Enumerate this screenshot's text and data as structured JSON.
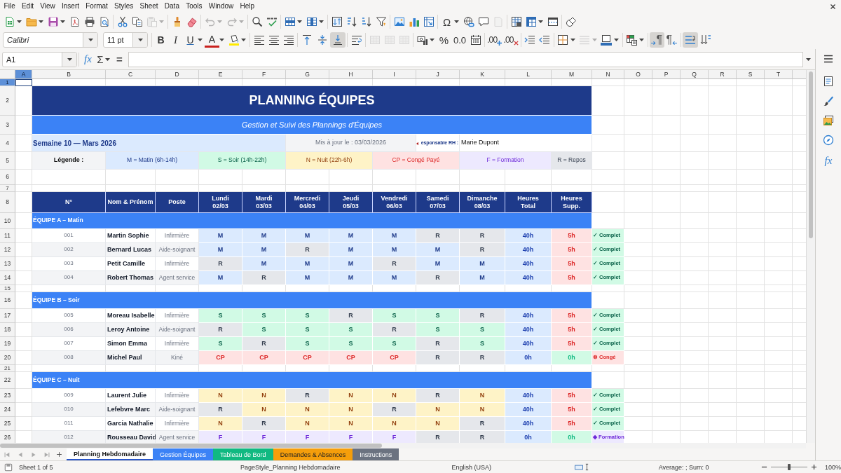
{
  "menu": [
    "File",
    "Edit",
    "View",
    "Insert",
    "Format",
    "Styles",
    "Sheet",
    "Data",
    "Tools",
    "Window",
    "Help"
  ],
  "standard_toolbar": {
    "paste": {
      "disabled": true
    },
    "undo": {
      "disabled": true
    },
    "redo": {
      "disabled": true
    },
    "special_character": "Ω",
    "header_footer": {
      "disabled": true
    }
  },
  "formatting_toolbar": {
    "font_name": "Calibri",
    "font_size": "11 pt",
    "bold": "B",
    "italic": "I",
    "underline": "U",
    "font_color": "A",
    "align_top": {
      "pressed": false
    },
    "align_middle": {
      "pressed": false
    },
    "align_bottom": {
      "pressed": true
    },
    "merge": {
      "disabled": true
    },
    "percent": "%",
    "standard_format": "0.0",
    "add_decimal": ".00",
    "delete_decimal": ".00",
    "border_style": {
      "disabled": true
    },
    "left_to_right": {
      "glyph": "¶",
      "pressed": true
    },
    "right_to_left": {
      "glyph": "¶",
      "pressed": false
    },
    "horizontal_text": {
      "pressed": true
    },
    "vertical_text": {
      "pressed": false
    }
  },
  "formula_bar": {
    "name_box": "A1",
    "function_wizard": "fx",
    "sum": "Σ",
    "formula": "="
  },
  "sidebar": {
    "functions": "fx"
  },
  "sheet": {
    "columns": [
      {
        "label": "A",
        "selected": true
      },
      {
        "label": "B",
        "selected": false
      },
      {
        "label": "C",
        "selected": false
      },
      {
        "label": "D",
        "selected": false
      },
      {
        "label": "E",
        "selected": false
      },
      {
        "label": "F",
        "selected": false
      },
      {
        "label": "G",
        "selected": false
      },
      {
        "label": "H",
        "selected": false
      },
      {
        "label": "I",
        "selected": false
      },
      {
        "label": "J",
        "selected": false
      },
      {
        "label": "K",
        "selected": false
      },
      {
        "label": "L",
        "selected": false
      },
      {
        "label": "M",
        "selected": false
      },
      {
        "label": "N",
        "selected": false
      },
      {
        "label": "O",
        "selected": false
      },
      {
        "label": "P",
        "selected": false
      },
      {
        "label": "Q",
        "selected": false
      },
      {
        "label": "R",
        "selected": false
      },
      {
        "label": "S",
        "selected": false
      },
      {
        "label": "T",
        "selected": false
      }
    ],
    "rows": [
      {
        "label": "1",
        "selected": true
      },
      {
        "label": "2",
        "selected": false
      },
      {
        "label": "3",
        "selected": false
      },
      {
        "label": "4",
        "selected": false
      },
      {
        "label": "5",
        "selected": false
      },
      {
        "label": "6",
        "selected": false
      },
      {
        "label": "7",
        "selected": false
      },
      {
        "label": "8",
        "selected": false
      },
      {
        "label": "10",
        "selected": false
      },
      {
        "label": "11",
        "selected": false
      },
      {
        "label": "12",
        "selected": false
      },
      {
        "label": "13",
        "selected": false
      },
      {
        "label": "14",
        "selected": false
      },
      {
        "label": "15",
        "selected": false
      },
      {
        "label": "16",
        "selected": false
      },
      {
        "label": "17",
        "selected": false
      },
      {
        "label": "18",
        "selected": false
      },
      {
        "label": "19",
        "selected": false
      },
      {
        "label": "20",
        "selected": false
      },
      {
        "label": "21",
        "selected": false
      },
      {
        "label": "22",
        "selected": false
      },
      {
        "label": "23",
        "selected": false
      },
      {
        "label": "24",
        "selected": false
      },
      {
        "label": "25",
        "selected": false
      },
      {
        "label": "26",
        "selected": false
      }
    ],
    "title": "PLANNING ÉQUIPES",
    "subtitle": "Gestion et Suivi des Plannings d'Équipes",
    "info": {
      "week": "Semaine 10 — Mars 2026",
      "updated": "Mis à jour le : 03/03/2026",
      "manager_label": "esponsable RH :",
      "manager": "Marie Dupont"
    },
    "legend": {
      "label": "Légende :",
      "items": [
        {
          "text": "M = Matin (6h-14h)",
          "kind": "matin"
        },
        {
          "text": "S = Soir (14h-22h)",
          "kind": "soir"
        },
        {
          "text": "N = Nuit (22h-6h)",
          "kind": "nuit"
        },
        {
          "text": "CP = Congé Payé",
          "kind": "conge"
        },
        {
          "text": "F = Formation",
          "kind": "formation"
        },
        {
          "text": "R = Repos",
          "kind": "repos"
        }
      ]
    },
    "table": {
      "columns": [
        "N°",
        "Nom & Prénom",
        "Poste",
        "Lundi\n02/03",
        "Mardi\n03/03",
        "Mercredi\n04/03",
        "Jeudi\n05/03",
        "Vendredi\n06/03",
        "Samedi\n07/03",
        "Dimanche\n08/03",
        "Heures\nTotal",
        "Heures\nSupp."
      ],
      "teams": [
        {
          "name": "ÉQUIPE A – Matin",
          "members": [
            {
              "number": "001",
              "name": "Martin Sophie",
              "role": "Infirmière",
              "shifts": [
                {
                  "code": "M",
                  "kind": "matin"
                },
                {
                  "code": "M",
                  "kind": "matin"
                },
                {
                  "code": "M",
                  "kind": "matin"
                },
                {
                  "code": "M",
                  "kind": "matin"
                },
                {
                  "code": "M",
                  "kind": "matin"
                },
                {
                  "code": "R",
                  "kind": "repos"
                },
                {
                  "code": "R",
                  "kind": "repos"
                }
              ],
              "total": "40h",
              "overtime": {
                "text": "5h",
                "kind": "extra"
              },
              "status": {
                "text": "✓ Complet",
                "kind": "complete"
              }
            },
            {
              "number": "002",
              "name": "Bernard Lucas",
              "role": "Aide-soignant",
              "shifts": [
                {
                  "code": "M",
                  "kind": "matin"
                },
                {
                  "code": "M",
                  "kind": "matin"
                },
                {
                  "code": "R",
                  "kind": "repos"
                },
                {
                  "code": "M",
                  "kind": "matin"
                },
                {
                  "code": "M",
                  "kind": "matin"
                },
                {
                  "code": "M",
                  "kind": "matin"
                },
                {
                  "code": "R",
                  "kind": "repos"
                }
              ],
              "total": "40h",
              "overtime": {
                "text": "5h",
                "kind": "extra"
              },
              "status": {
                "text": "✓ Complet",
                "kind": "complete"
              }
            },
            {
              "number": "003",
              "name": "Petit Camille",
              "role": "Infirmière",
              "shifts": [
                {
                  "code": "R",
                  "kind": "repos"
                },
                {
                  "code": "M",
                  "kind": "matin"
                },
                {
                  "code": "M",
                  "kind": "matin"
                },
                {
                  "code": "M",
                  "kind": "matin"
                },
                {
                  "code": "R",
                  "kind": "repos"
                },
                {
                  "code": "M",
                  "kind": "matin"
                },
                {
                  "code": "M",
                  "kind": "matin"
                }
              ],
              "total": "40h",
              "overtime": {
                "text": "5h",
                "kind": "extra"
              },
              "status": {
                "text": "✓ Complet",
                "kind": "complete"
              }
            },
            {
              "number": "004",
              "name": "Robert Thomas",
              "role": "Agent service",
              "shifts": [
                {
                  "code": "M",
                  "kind": "matin"
                },
                {
                  "code": "R",
                  "kind": "repos"
                },
                {
                  "code": "M",
                  "kind": "matin"
                },
                {
                  "code": "M",
                  "kind": "matin"
                },
                {
                  "code": "M",
                  "kind": "matin"
                },
                {
                  "code": "R",
                  "kind": "repos"
                },
                {
                  "code": "M",
                  "kind": "matin"
                }
              ],
              "total": "40h",
              "overtime": {
                "text": "5h",
                "kind": "extra"
              },
              "status": {
                "text": "✓ Complet",
                "kind": "complete"
              }
            }
          ]
        },
        {
          "name": "ÉQUIPE B – Soir",
          "members": [
            {
              "number": "005",
              "name": "Moreau Isabelle",
              "role": "Infirmière",
              "shifts": [
                {
                  "code": "S",
                  "kind": "soir"
                },
                {
                  "code": "S",
                  "kind": "soir"
                },
                {
                  "code": "S",
                  "kind": "soir"
                },
                {
                  "code": "R",
                  "kind": "repos"
                },
                {
                  "code": "S",
                  "kind": "soir"
                },
                {
                  "code": "S",
                  "kind": "soir"
                },
                {
                  "code": "R",
                  "kind": "repos"
                }
              ],
              "total": "40h",
              "overtime": {
                "text": "5h",
                "kind": "extra"
              },
              "status": {
                "text": "✓ Complet",
                "kind": "complete"
              }
            },
            {
              "number": "006",
              "name": "Leroy Antoine",
              "role": "Aide-soignant",
              "shifts": [
                {
                  "code": "R",
                  "kind": "repos"
                },
                {
                  "code": "S",
                  "kind": "soir"
                },
                {
                  "code": "S",
                  "kind": "soir"
                },
                {
                  "code": "S",
                  "kind": "soir"
                },
                {
                  "code": "R",
                  "kind": "repos"
                },
                {
                  "code": "S",
                  "kind": "soir"
                },
                {
                  "code": "S",
                  "kind": "soir"
                }
              ],
              "total": "40h",
              "overtime": {
                "text": "5h",
                "kind": "extra"
              },
              "status": {
                "text": "✓ Complet",
                "kind": "complete"
              }
            },
            {
              "number": "007",
              "name": "Simon Emma",
              "role": "Infirmière",
              "shifts": [
                {
                  "code": "S",
                  "kind": "soir"
                },
                {
                  "code": "R",
                  "kind": "repos"
                },
                {
                  "code": "S",
                  "kind": "soir"
                },
                {
                  "code": "S",
                  "kind": "soir"
                },
                {
                  "code": "S",
                  "kind": "soir"
                },
                {
                  "code": "R",
                  "kind": "repos"
                },
                {
                  "code": "S",
                  "kind": "soir"
                }
              ],
              "total": "40h",
              "overtime": {
                "text": "5h",
                "kind": "extra"
              },
              "status": {
                "text": "✓ Complet",
                "kind": "complete"
              }
            },
            {
              "number": "008",
              "name": "Michel Paul",
              "role": "Kiné",
              "shifts": [
                {
                  "code": "CP",
                  "kind": "conge"
                },
                {
                  "code": "CP",
                  "kind": "conge"
                },
                {
                  "code": "CP",
                  "kind": "conge"
                },
                {
                  "code": "CP",
                  "kind": "conge"
                },
                {
                  "code": "CP",
                  "kind": "conge"
                },
                {
                  "code": "R",
                  "kind": "repos"
                },
                {
                  "code": "R",
                  "kind": "repos"
                }
              ],
              "total": "0h",
              "overtime": {
                "text": "0h",
                "kind": "none"
              },
              "status": {
                "text": "⊗ Congé",
                "kind": "leave"
              }
            }
          ]
        },
        {
          "name": "ÉQUIPE C – Nuit",
          "members": [
            {
              "number": "009",
              "name": "Laurent Julie",
              "role": "Infirmière",
              "shifts": [
                {
                  "code": "N",
                  "kind": "nuit"
                },
                {
                  "code": "N",
                  "kind": "nuit"
                },
                {
                  "code": "R",
                  "kind": "repos"
                },
                {
                  "code": "N",
                  "kind": "nuit"
                },
                {
                  "code": "N",
                  "kind": "nuit"
                },
                {
                  "code": "R",
                  "kind": "repos"
                },
                {
                  "code": "N",
                  "kind": "nuit"
                }
              ],
              "total": "40h",
              "overtime": {
                "text": "5h",
                "kind": "extra"
              },
              "status": {
                "text": "✓ Complet",
                "kind": "complete"
              }
            },
            {
              "number": "010",
              "name": "Lefebvre Marc",
              "role": "Aide-soignant",
              "shifts": [
                {
                  "code": "R",
                  "kind": "repos"
                },
                {
                  "code": "N",
                  "kind": "nuit"
                },
                {
                  "code": "N",
                  "kind": "nuit"
                },
                {
                  "code": "N",
                  "kind": "nuit"
                },
                {
                  "code": "R",
                  "kind": "repos"
                },
                {
                  "code": "N",
                  "kind": "nuit"
                },
                {
                  "code": "N",
                  "kind": "nuit"
                }
              ],
              "total": "40h",
              "overtime": {
                "text": "5h",
                "kind": "extra"
              },
              "status": {
                "text": "✓ Complet",
                "kind": "complete"
              }
            },
            {
              "number": "011",
              "name": "Garcia Nathalie",
              "role": "Infirmière",
              "shifts": [
                {
                  "code": "N",
                  "kind": "nuit"
                },
                {
                  "code": "R",
                  "kind": "repos"
                },
                {
                  "code": "N",
                  "kind": "nuit"
                },
                {
                  "code": "N",
                  "kind": "nuit"
                },
                {
                  "code": "N",
                  "kind": "nuit"
                },
                {
                  "code": "N",
                  "kind": "nuit"
                },
                {
                  "code": "R",
                  "kind": "repos"
                }
              ],
              "total": "40h",
              "overtime": {
                "text": "5h",
                "kind": "extra"
              },
              "status": {
                "text": "✓ Complet",
                "kind": "complete"
              }
            },
            {
              "number": "012",
              "name": "Rousseau David",
              "role": "Agent service",
              "shifts": [
                {
                  "code": "F",
                  "kind": "formation"
                },
                {
                  "code": "F",
                  "kind": "formation"
                },
                {
                  "code": "F",
                  "kind": "formation"
                },
                {
                  "code": "F",
                  "kind": "formation"
                },
                {
                  "code": "F",
                  "kind": "formation"
                },
                {
                  "code": "R",
                  "kind": "repos"
                },
                {
                  "code": "R",
                  "kind": "repos"
                }
              ],
              "total": "0h",
              "overtime": {
                "text": "0h",
                "kind": "none"
              },
              "status": {
                "text": "◆ Formation",
                "kind": "training"
              }
            }
          ]
        }
      ]
    }
  },
  "sheet_tabs": [
    {
      "label": "Planning Hebdomadaire",
      "selected": true,
      "color": "#2855c8"
    },
    {
      "label": "Gestion Équipes",
      "selected": false,
      "color": "#3b82f6"
    },
    {
      "label": "Tableau de Bord",
      "selected": false,
      "color": "#10b981"
    },
    {
      "label": "Demandes & Absences",
      "selected": false,
      "color": "#f59e0b"
    },
    {
      "label": "Instructions",
      "selected": false,
      "color": "#6b7280"
    }
  ],
  "status_bar": {
    "sheet_position": "Sheet 1 of 5",
    "page_style": "PageStyle_Planning Hebdomadaire",
    "language": "English (USA)",
    "selection_summary": "Average: ; Sum: 0",
    "zoom_slider": {
      "level": 0.5
    },
    "zoom": "100%"
  }
}
